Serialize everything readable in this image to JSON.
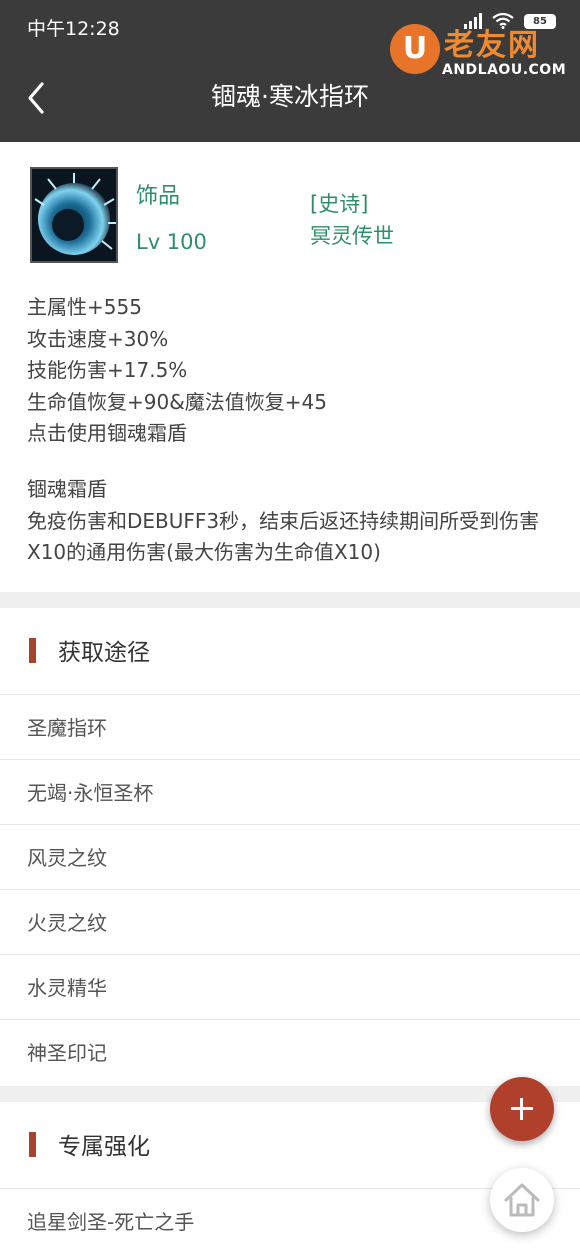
{
  "status_bar": {
    "time": "中午12:28",
    "battery": "85"
  },
  "watermark": {
    "logo_letter": "U",
    "brand": "老友网",
    "domain": "ANDLAOU.COM"
  },
  "header": {
    "title": "锢魂·寒冰指环"
  },
  "item": {
    "type": "饰品",
    "level": "Lv 100",
    "rarity": "[史诗]",
    "set": "冥灵传世",
    "stats": [
      "主属性+555",
      "攻击速度+30%",
      "技能伤害+17.5%",
      "生命值恢复+90&魔法值恢复+45",
      "点击使用锢魂霜盾"
    ],
    "skill_name": "锢魂霜盾",
    "skill_desc": "免疫伤害和DEBUFF3秒，结束后返还持续期间所受到伤害X10的通用伤害(最大伤害为生命值X10)"
  },
  "sources": {
    "title": "获取途径",
    "items": [
      "圣魔指环",
      "无竭·永恒圣杯",
      "风灵之纹",
      "火灵之纹",
      "水灵精华",
      "神圣印记"
    ]
  },
  "exclusive": {
    "title": "专属强化",
    "items": [
      "追星剑圣-死亡之手"
    ]
  },
  "colors": {
    "accent": "#a9442c",
    "green_text": "#2f8f6a",
    "header_bg": "#3b3b3b"
  }
}
